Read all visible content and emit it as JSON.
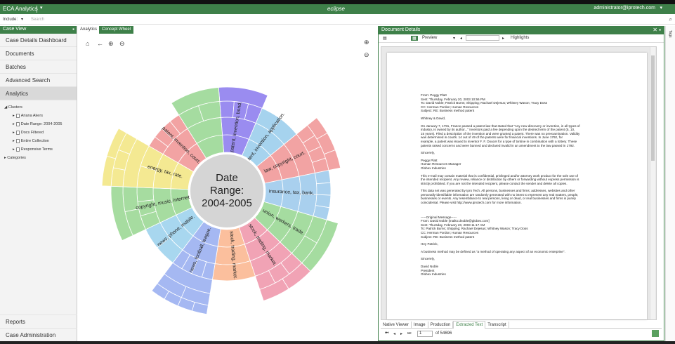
{
  "header": {
    "app_name": "ECA Analytics",
    "brand": "eclipse",
    "user": "administrator@iprotech.com"
  },
  "include_bar": {
    "label": "Include:",
    "search_placeholder": "Search"
  },
  "sidebar": {
    "title": "Case View",
    "items": [
      {
        "label": "Case Details Dashboard"
      },
      {
        "label": "Documents"
      },
      {
        "label": "Batches"
      },
      {
        "label": "Advanced Search"
      },
      {
        "label": "Analytics"
      }
    ],
    "tree_root": "Clusters",
    "tree_children": [
      "Ariana Akers",
      "Date Range: 2004-2005",
      "Docs Filtered",
      "Entire Collection",
      "Responsive Terms"
    ],
    "tree_sibling": "Categories",
    "bottom_items": [
      {
        "label": "Reports"
      },
      {
        "label": "Case Administration"
      }
    ]
  },
  "center": {
    "tab_analytics": "Analytics",
    "tab_concept_wheel": "Concept Wheel",
    "center_label_1": "Date",
    "center_label_2": "Range:",
    "center_label_3": "2004-2005",
    "segment_labels": [
      "patent, invention, bond.",
      "patent, invention, application.",
      "law, copyright, court.",
      "insurance, tax, bank.",
      "union, workers, trade.",
      "stock, trading, market.",
      "stock, trading, market.",
      "news, football, league.",
      "news, phone, mobile.",
      "copyright, music, internet.",
      "energy, tax, rate.",
      "patent, invention, court."
    ]
  },
  "document": {
    "title": "Document Details",
    "toolbar": {
      "view": "Preview",
      "highlights": "Highlights"
    },
    "lines": [
      "From: Peggy Platt",
      "Sent: Thursday, February 20, 2003 10:56 PM",
      "To: David Noble; Patrick Burns; Shipping; Rachael Dejesus; Whitney Wason; Tracy Doss",
      "CC: Herman Pordon; Human Resources",
      "Subject: RE: Business method patent",
      "",
      "Whitney & David,",
      "",
      "On January 7, 1791, France passed a patent law that stated that \"Any new discovery or invention, in all types of",
      "industry, is owned by its author...\" Inventors paid a fee depending upon the desired term of the patent (5, 10,",
      "15 years). Filed a description of the invention and were granted a patent. There was no preexamination. Validity",
      "was determined in courts. 14 out of 49 of the patents were for financial inventions. In June 1792, for",
      "example, a patent was issued to inventor F. F. Doucet for a type of tontine in combination with a lottery. These",
      "patents raised concerns and were banned and declared invalid in an amendment to the law passed in 1792.",
      "",
      "Sincerely,",
      "",
      "Peggy Platt",
      "Human Resources Manager",
      "Globex Industries",
      "",
      "This e-mail may contain material that is confidential, privileged and/or attorney work product for the sole use of",
      "the intended recipient. Any review, reliance or distribution by others or forwarding without express permission is",
      "strictly prohibited. If you are not the intended recipient, please contact the sender and delete all copies.",
      "",
      "This data set was generated by Ipro Tech. All persons, businesses and firms; addresses, websites and other",
      "personally-identifiable information are randomly generated with no intent to represent any real matters, people,",
      "businesses or events. Any resemblance to real persons, living or dead, or real businesses and firms is purely",
      "coincidental. Please visit http://www.iprotech.com for more information.",
      "",
      "",
      "",
      "-----Original Message-----",
      "From: David Noble [mailto:dnoble@globex.com]",
      "Sent: Thursday, February 20, 2003 11:17 AM",
      "To: Patrick Burns; Shipping; Rachael Dejesus; Whitney Wason; Tracy Doss",
      "CC: Herman Pordon; Human Resources",
      "Subject: RE: Business method patent",
      "",
      "Hey Patrick,",
      "",
      "A business method may be defined as \"a method of operating any aspect of an economic enterprise\".",
      "",
      "Sincerely,",
      "",
      "David Noble",
      "President",
      "Globex Industries"
    ],
    "bottom_tabs": [
      "Native Viewer",
      "Image",
      "Production",
      "Extracted Text",
      "Transcript"
    ],
    "page_current": "1",
    "page_total": "of 54696"
  },
  "right_strip": {
    "label": "Tags"
  }
}
